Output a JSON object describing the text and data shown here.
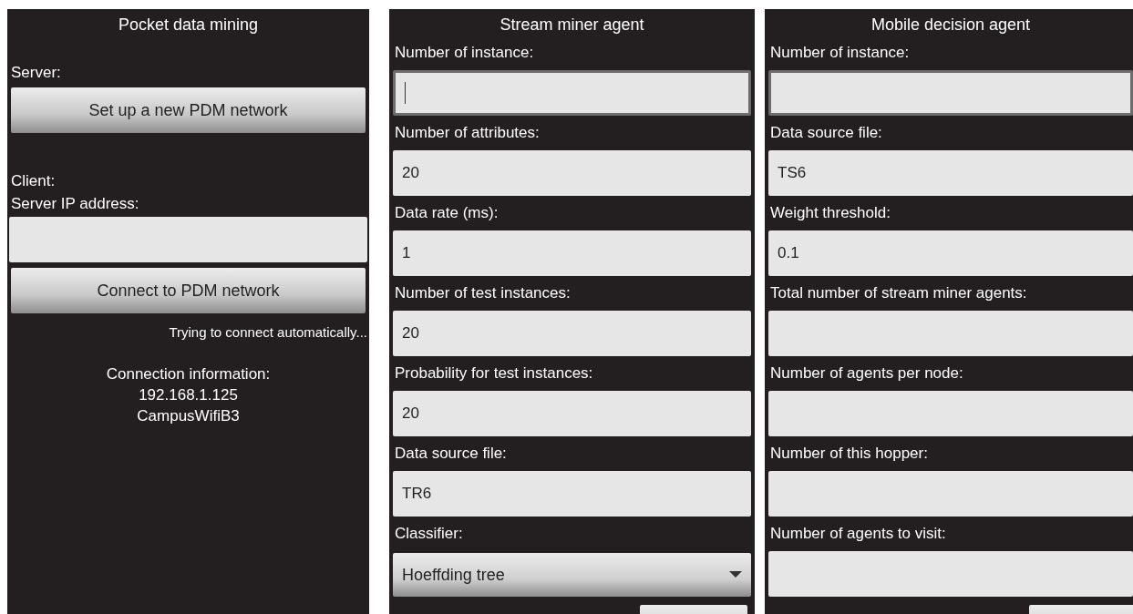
{
  "screens": [
    {
      "title": "Pocket data mining",
      "items": [
        {
          "kind": "label",
          "text": "Server:"
        },
        {
          "kind": "button",
          "text": "Set up a new PDM network"
        },
        {
          "kind": "spacer"
        },
        {
          "kind": "label",
          "text": "Client:"
        },
        {
          "kind": "label",
          "text": "Server IP address:"
        },
        {
          "kind": "field",
          "value": "",
          "focused": false
        },
        {
          "kind": "button",
          "text": "Connect to PDM network"
        },
        {
          "kind": "status",
          "text": "Trying to connect automatically..."
        },
        {
          "kind": "info",
          "lines": [
            "Connection information:",
            "192.168.1.125",
            "CampusWifiB3"
          ]
        }
      ],
      "cut_button": false
    },
    {
      "title": "Stream miner agent",
      "items": [
        {
          "kind": "label",
          "text": "Number of instance:"
        },
        {
          "kind": "field",
          "value": "",
          "focused": true,
          "cursor": true
        },
        {
          "kind": "label",
          "text": "Number of attributes:"
        },
        {
          "kind": "field",
          "value": "20",
          "focused": false
        },
        {
          "kind": "label",
          "text": "Data rate (ms):"
        },
        {
          "kind": "field",
          "value": "1",
          "focused": false
        },
        {
          "kind": "label",
          "text": "Number of test instances:"
        },
        {
          "kind": "field",
          "value": "20",
          "focused": false
        },
        {
          "kind": "label",
          "text": "Probability for test instances:"
        },
        {
          "kind": "field",
          "value": "20",
          "focused": false
        },
        {
          "kind": "label",
          "text": "Data source file:"
        },
        {
          "kind": "field",
          "value": "TR6",
          "focused": false
        },
        {
          "kind": "label",
          "text": "Classifier:"
        },
        {
          "kind": "dropdown",
          "value": "Hoeffding tree"
        }
      ],
      "cut_button": true
    },
    {
      "title": "Mobile decision agent",
      "items": [
        {
          "kind": "label",
          "text": "Number of instance:"
        },
        {
          "kind": "field",
          "value": "",
          "focused": true
        },
        {
          "kind": "label",
          "text": "Data source file:"
        },
        {
          "kind": "field",
          "value": "TS6",
          "focused": false
        },
        {
          "kind": "label",
          "text": "Weight threshold:"
        },
        {
          "kind": "field",
          "value": "0.1",
          "focused": false
        },
        {
          "kind": "label",
          "text": "Total number of stream miner agents:"
        },
        {
          "kind": "field",
          "value": "",
          "focused": false
        },
        {
          "kind": "label",
          "text": "Number of agents per node:"
        },
        {
          "kind": "field",
          "value": "",
          "focused": false
        },
        {
          "kind": "label",
          "text": "Number of this hopper:"
        },
        {
          "kind": "field",
          "value": "",
          "focused": false
        },
        {
          "kind": "label",
          "text": "Number of agents to visit:"
        },
        {
          "kind": "field",
          "value": "",
          "focused": false
        }
      ],
      "cut_button": true
    }
  ]
}
